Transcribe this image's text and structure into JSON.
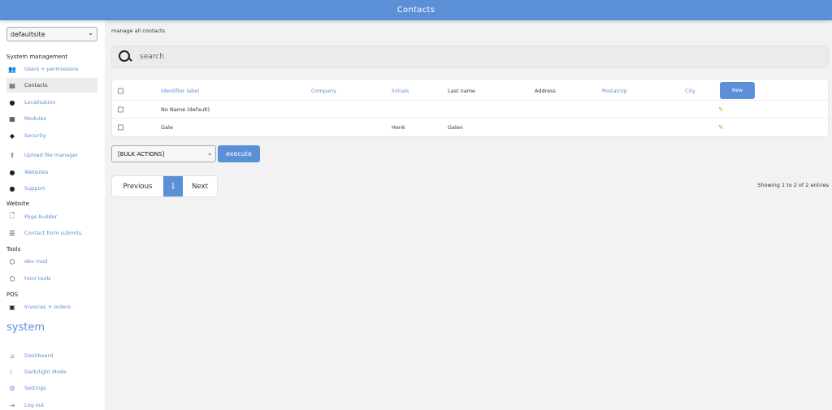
{
  "header": {
    "title": "Contacts"
  },
  "sidebar": {
    "site_select": "defaultsite",
    "sections": {
      "system_management": "System management",
      "website": "Website",
      "tools": "Tools",
      "pos": "POS"
    },
    "items": [
      {
        "label": "Users + permissions",
        "icon": "users-icon"
      },
      {
        "label": "Contacts",
        "icon": "contacts-icon"
      },
      {
        "label": "Localisation",
        "icon": "globe-icon"
      },
      {
        "label": "Modules",
        "icon": "modules-icon"
      },
      {
        "label": "Security",
        "icon": "security-icon"
      },
      {
        "label": "Upload file manager",
        "icon": "upload-icon"
      },
      {
        "label": "Websites",
        "icon": "globe-icon"
      },
      {
        "label": "Support",
        "icon": "chat-icon"
      },
      {
        "label": "Page builder",
        "icon": "page-icon"
      },
      {
        "label": "Contact form submits",
        "icon": "form-icon"
      },
      {
        "label": "dev mod",
        "icon": "cube-icon"
      },
      {
        "label": "html tools",
        "icon": "cube-icon"
      },
      {
        "label": "Invoices + orders",
        "icon": "invoice-icon"
      }
    ],
    "system_label": "system",
    "system_items": [
      {
        "label": "Dashboard",
        "icon": "home-icon"
      },
      {
        "label": "Dark/light Mode",
        "icon": "moon-icon"
      },
      {
        "label": "Settings",
        "icon": "gear-icon"
      },
      {
        "label": "Log out",
        "icon": "logout-icon"
      }
    ]
  },
  "main": {
    "subtitle": "manage all contacts",
    "search_placeholder": "search",
    "table": {
      "columns": [
        "Identifier label",
        "Company",
        "Initials",
        "Last name",
        "Address",
        "Postal/zip",
        "City"
      ],
      "new_label": "New",
      "rows": [
        [
          "No Name (default)",
          "",
          "",
          "",
          "",
          "",
          ""
        ],
        [
          "Gale",
          "",
          "Henk",
          "Galen",
          "",
          "",
          ""
        ]
      ]
    },
    "bulk_actions": "[BULK ACTIONS]",
    "execute": "execute",
    "pagination": {
      "previous": "Previous",
      "current": "1",
      "next": "Next"
    },
    "showing": "Showing 1 to 2 of 2 entries"
  },
  "colors": {
    "accent": "#5b8fd6",
    "background": "#f2f2f2"
  }
}
